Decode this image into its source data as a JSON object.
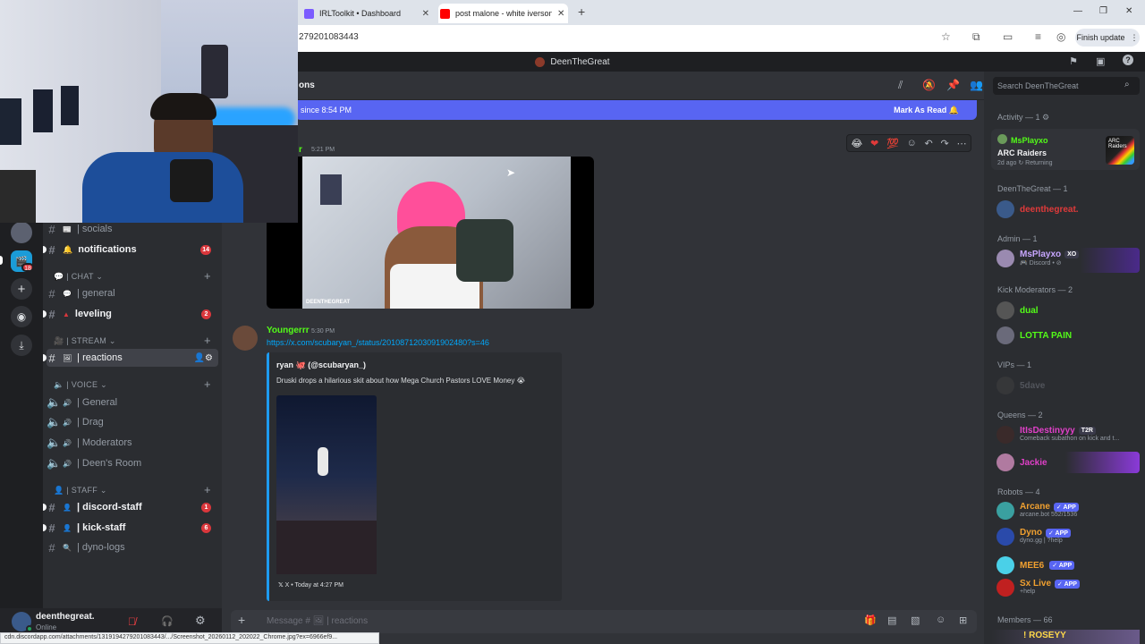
{
  "browser": {
    "tabs": [
      {
        "title": "IRLToolkit • Dashboard",
        "fav": "#7b5cff"
      },
      {
        "title": "post malone - white iverson (",
        "fav": "#ff0000"
      }
    ],
    "url": "279201083443",
    "finish_update": "Finish update",
    "status_url": "cdn.discordapp.com/attachments/1319194279201083443/.../Screenshot_20260112_202022_Chrome.jpg?ex=6966ef9..."
  },
  "window_title": "DeenTheGreat",
  "rail": {
    "badge": "18"
  },
  "channels": {
    "top": [
      {
        "icon": "📰",
        "name": "| socials",
        "badge": ""
      },
      {
        "icon": "🔔",
        "name": "notifications",
        "badge": "14"
      }
    ],
    "chat_category": "| CHAT",
    "chat": [
      {
        "icon": "💬",
        "name": "| general",
        "badge": ""
      },
      {
        "icon": "▲",
        "name": "leveling",
        "badge": "2"
      }
    ],
    "stream_category": "| STREAM",
    "stream": [
      {
        "icon": "🖼",
        "name": "| reactions"
      }
    ],
    "voice_category": "| VOICE",
    "voice": [
      "| General",
      "| Drag",
      "| Moderators",
      "| Deen's Room"
    ],
    "staff_category": "| STAFF",
    "staff": [
      {
        "name": "| discord-staff",
        "badge": "1"
      },
      {
        "name": "| kick-staff",
        "badge": "6"
      },
      {
        "name": "| dyno-logs",
        "badge": ""
      }
    ]
  },
  "user": {
    "name": "deenthegreat.",
    "status": "Online"
  },
  "header": {
    "channel_fragment": "ons",
    "search_placeholder": "Search DeenTheGreat"
  },
  "newbar": {
    "text": "since 8:54 PM",
    "mark_read": "Mark As Read"
  },
  "messages": {
    "first": {
      "name_fragment": "r",
      "time": "5:21 PM",
      "watermark": "DEENTHEGREAT"
    },
    "second": {
      "author": "Youngerrr",
      "time": "5:30 PM",
      "link": "https://x.com/scubaryan_/status/2010871203091902480?s=46",
      "embed_author": "ryan 🐙 (@scubaryan_)",
      "embed_text": "Druski drops a hilarious skit about how Mega Church Pastors LOVE Money 😭",
      "embed_footer": "X • Today at 4:27 PM"
    }
  },
  "composer": {
    "placeholder": "Message # 🖼 | reactions"
  },
  "members": {
    "activity_header": "Activity — 1",
    "activity": {
      "name": "MsPlayxo",
      "game": "ARC Raiders",
      "meta": "2d ago  ↻ Returning",
      "art": "ARC Raiders"
    },
    "sections": [
      {
        "title": "DeenTheGreat — 1",
        "members": [
          {
            "name": "deenthegreat.",
            "color": "#e03a3a",
            "sub": "",
            "tag": ""
          }
        ]
      },
      {
        "title": "Admin — 1",
        "members": [
          {
            "name": "MsPlayxo",
            "color": "#c7a6ff",
            "sub": "🎮 Discord • ⊘",
            "tag": "XO"
          }
        ]
      },
      {
        "title": "Kick Moderators — 2",
        "members": [
          {
            "name": "dual",
            "color": "#53fc18",
            "sub": "",
            "tag": ""
          },
          {
            "name": "LOTTA PAIN",
            "color": "#53fc18",
            "sub": "",
            "tag": ""
          }
        ]
      },
      {
        "title": "VIPs — 1",
        "members": [
          {
            "name": "5dave",
            "color": "#5a5d63",
            "sub": "",
            "tag": ""
          }
        ]
      },
      {
        "title": "Queens — 2",
        "members": [
          {
            "name": "ItIsDestinyyy",
            "color": "#e040c8",
            "sub": "Comeback subathon on kick and t...",
            "tag": "T2R"
          },
          {
            "name": "Jackie",
            "color": "#e040c8",
            "sub": "",
            "tag": ""
          }
        ]
      },
      {
        "title": "Robots — 4",
        "members": [
          {
            "name": "Arcane",
            "color": "#f0a030",
            "sub": "arcane.bot 552/1536",
            "tag": "✓ APP"
          },
          {
            "name": "Dyno",
            "color": "#f0a030",
            "sub": "dyno.gg | ?help",
            "tag": "✓ APP"
          },
          {
            "name": "MEE6",
            "color": "#f0a030",
            "sub": "",
            "tag": "✓ APP"
          },
          {
            "name": "Sx Live",
            "color": "#f0a030",
            "sub": "+help",
            "tag": "✓ APP"
          }
        ]
      }
    ],
    "footer_header": "Members — 66",
    "footer_name": "! ROSEYY"
  }
}
